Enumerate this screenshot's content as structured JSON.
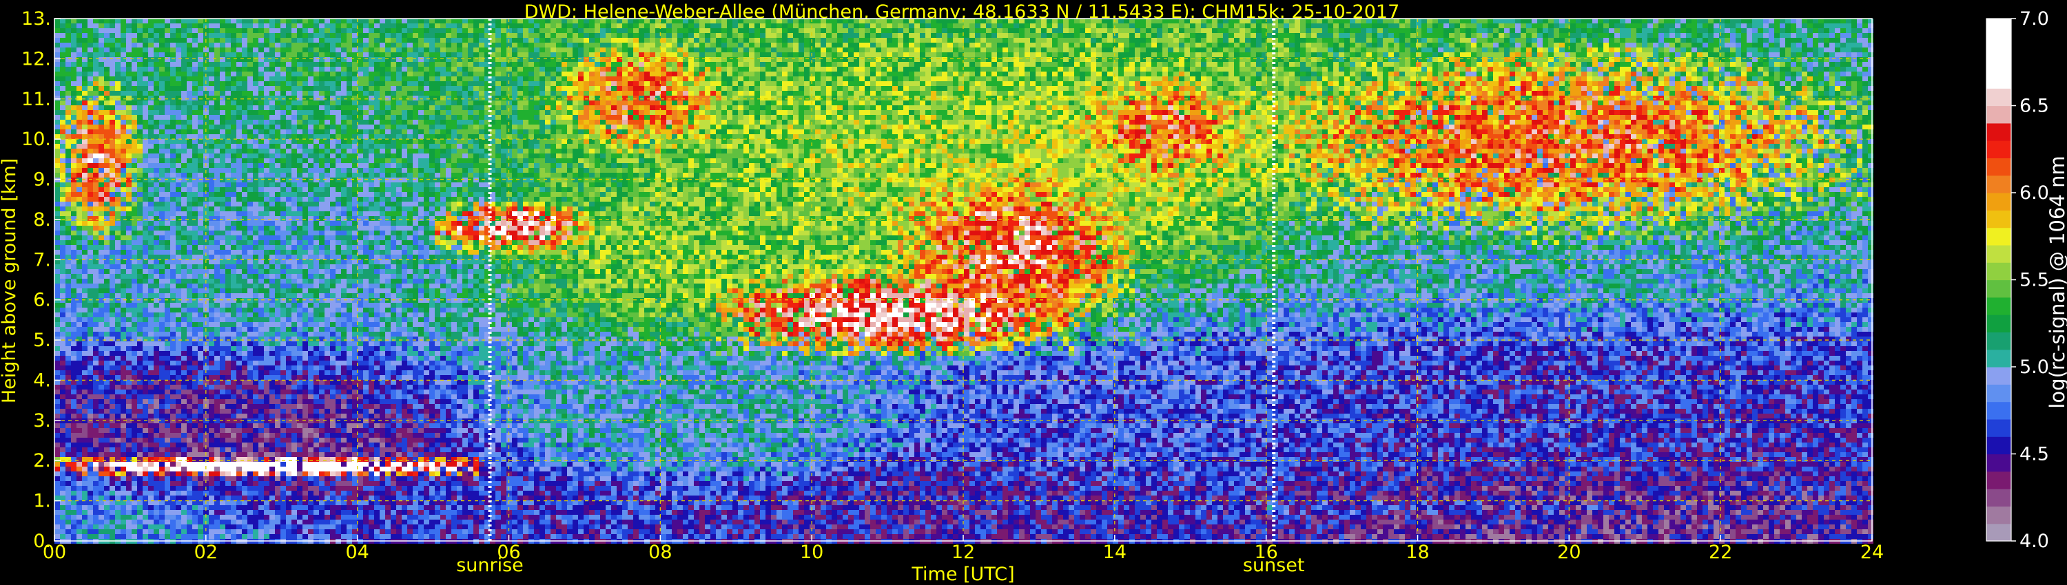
{
  "chart_data": {
    "type": "heatmap",
    "title": "DWD: Helene-Weber-Allee (München, Germany; 48.1633 N / 11.5433 E):    CHM15k: 25-10-2017",
    "xlabel": "Time [UTC]",
    "ylabel": "Height above ground [km]",
    "xlim": [
      0,
      24
    ],
    "ylim": [
      0,
      13
    ],
    "x_ticks": [
      0,
      2,
      4,
      6,
      8,
      10,
      12,
      14,
      16,
      18,
      20,
      22,
      24
    ],
    "x_tick_labels": [
      "00",
      "02",
      "04",
      "06",
      "08",
      "10",
      "12",
      "14",
      "16",
      "18",
      "20",
      "22",
      "24"
    ],
    "y_ticks": [
      0,
      1,
      2,
      3,
      4,
      5,
      6,
      7,
      8,
      9,
      10,
      11,
      12,
      13
    ],
    "y_tick_labels": [
      "0.",
      "1.",
      "2.",
      "3.",
      "4.",
      "5.",
      "6.",
      "7.",
      "8.",
      "9.",
      "10.",
      "11.",
      "12.",
      "13."
    ],
    "grid": true,
    "events": [
      {
        "label": "sunrise",
        "time": 5.75
      },
      {
        "label": "sunset",
        "time": 16.1
      }
    ],
    "colorbar": {
      "label": "log(rc-signal) @ 1064 nm",
      "range": [
        4.0,
        7.0
      ],
      "tick_values": [
        4.0,
        4.5,
        5.0,
        5.5,
        6.0,
        6.5,
        7.0
      ],
      "tick_labels": [
        "4.0",
        "4.5",
        "5.0",
        "5.5",
        "6.0",
        "6.5",
        "7.0"
      ],
      "colors": [
        "#a89ab8",
        "#a07aa0",
        "#8a4a8a",
        "#7a1a70",
        "#4a0a90",
        "#1a10b0",
        "#2040d8",
        "#3a70f0",
        "#6090f0",
        "#8aa0f0",
        "#2ab0a0",
        "#18a070",
        "#10a040",
        "#20b030",
        "#60c040",
        "#90d040",
        "#c0e040",
        "#f0f020",
        "#f0c010",
        "#f0a010",
        "#f08020",
        "#f05010",
        "#f02010",
        "#e01010",
        "#e8b0b0",
        "#f0d0d0",
        "#ffffff",
        "#ffffff",
        "#ffffff",
        "#ffffff"
      ]
    },
    "background_field": [
      {
        "t": 0.0,
        "h": 0.0,
        "v": 4.9
      },
      {
        "t": 6.0,
        "h": 0.5,
        "v": 4.6
      },
      {
        "t": 12.0,
        "h": 0.5,
        "v": 4.5
      },
      {
        "t": 20.0,
        "h": 0.5,
        "v": 4.4
      },
      {
        "t": 3.0,
        "h": 2.5,
        "v": 4.4
      },
      {
        "t": 8.0,
        "h": 3.0,
        "v": 5.0
      },
      {
        "t": 14.0,
        "h": 3.0,
        "v": 4.7
      },
      {
        "t": 20.0,
        "h": 3.0,
        "v": 4.6
      },
      {
        "t": 3.0,
        "h": 7.0,
        "v": 5.0
      },
      {
        "t": 9.0,
        "h": 7.0,
        "v": 5.5
      },
      {
        "t": 13.0,
        "h": 9.0,
        "v": 5.6
      },
      {
        "t": 20.0,
        "h": 8.0,
        "v": 5.0
      }
    ],
    "features": [
      {
        "name": "cirrus-00-01",
        "t0": 0.0,
        "t1": 1.15,
        "h0": 7.4,
        "h1": 11.6,
        "v": 6.3
      },
      {
        "name": "boundary-layer-top-night",
        "t0": 0.0,
        "t1": 5.6,
        "h0": 1.6,
        "h1": 2.1,
        "v": 7.0
      },
      {
        "name": "cloud-05-07",
        "t0": 5.0,
        "t1": 7.1,
        "h0": 7.1,
        "h1": 8.5,
        "v": 6.5
      },
      {
        "name": "cirrus-06-09",
        "t0": 6.5,
        "t1": 9.0,
        "h0": 9.3,
        "h1": 12.8,
        "v": 6.2
      },
      {
        "name": "cloud-09-13",
        "t0": 8.7,
        "t1": 13.5,
        "h0": 4.6,
        "h1": 6.8,
        "v": 6.6
      },
      {
        "name": "cirrus-11-14",
        "t0": 11.0,
        "t1": 14.3,
        "h0": 5.0,
        "h1": 9.5,
        "v": 6.4
      },
      {
        "name": "cirrus-13-16",
        "t0": 13.3,
        "t1": 16.0,
        "h0": 8.5,
        "h1": 12.0,
        "v": 6.2
      },
      {
        "name": "cirrus-15-24",
        "t0": 15.5,
        "t1": 24.0,
        "h0": 7.3,
        "h1": 12.7,
        "v": 6.2
      },
      {
        "name": "boundary-layer-day",
        "t0": 9.0,
        "t1": 24.0,
        "h0": 0.1,
        "h1": 1.5,
        "v": 4.6
      }
    ]
  }
}
